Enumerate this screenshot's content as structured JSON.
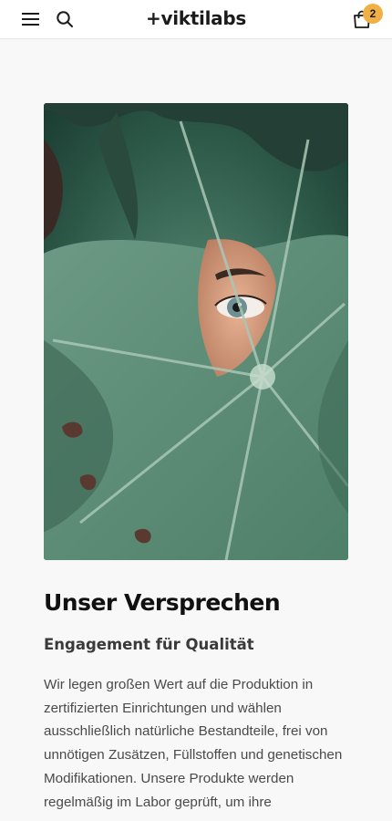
{
  "header": {
    "menu_icon": "hamburger-menu-icon",
    "search_icon": "search-icon",
    "logo_text": "+viktilabs",
    "cart_icon": "shopping-bag-icon",
    "cart_count": "2",
    "badge_color": "#f0b045"
  },
  "hero": {
    "image": "woman's eye peeking through a large green monstera-like leaf"
  },
  "section": {
    "title": "Unser Versprechen",
    "subtitle": "Engagement für Qualität",
    "body": "Wir legen großen Wert auf die Produktion in zertifizierten Einrichtungen und wählen ausschließlich natürliche Bestandteile, frei von unnötigen Zusätzen, Füllstoffen und genetischen Modifikationen. Unsere Produkte werden regelmäßig im Labor geprüft, um ihre"
  }
}
